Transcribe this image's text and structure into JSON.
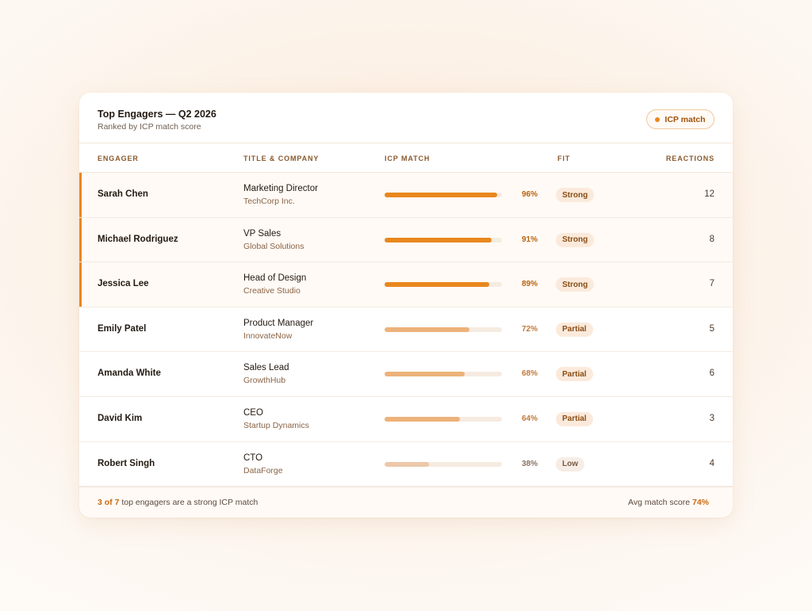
{
  "header": {
    "title": "Top Engagers — Q2 2026",
    "subtitle": "Ranked by ICP match score",
    "pill_label": "ICP match"
  },
  "columns": {
    "engager": "ENGAGER",
    "title_company": "TITLE & COMPANY",
    "icp_match": "ICP MATCH",
    "fit": "FIT",
    "reactions": "REACTIONS"
  },
  "rows": [
    {
      "name": "Sarah Chen",
      "title": "Marketing Director",
      "company": "TechCorp Inc.",
      "match_pct": 96,
      "match_label": "96%",
      "fit": "Strong",
      "reactions": "12"
    },
    {
      "name": "Michael Rodriguez",
      "title": "VP Sales",
      "company": "Global Solutions",
      "match_pct": 91,
      "match_label": "91%",
      "fit": "Strong",
      "reactions": "8"
    },
    {
      "name": "Jessica Lee",
      "title": "Head of Design",
      "company": "Creative Studio",
      "match_pct": 89,
      "match_label": "89%",
      "fit": "Strong",
      "reactions": "7"
    },
    {
      "name": "Emily Patel",
      "title": "Product Manager",
      "company": "InnovateNow",
      "match_pct": 72,
      "match_label": "72%",
      "fit": "Partial",
      "reactions": "5"
    },
    {
      "name": "Amanda White",
      "title": "Sales Lead",
      "company": "GrowthHub",
      "match_pct": 68,
      "match_label": "68%",
      "fit": "Partial",
      "reactions": "6"
    },
    {
      "name": "David Kim",
      "title": "CEO",
      "company": "Startup Dynamics",
      "match_pct": 64,
      "match_label": "64%",
      "fit": "Partial",
      "reactions": "3"
    },
    {
      "name": "Robert Singh",
      "title": "CTO",
      "company": "DataForge",
      "match_pct": 38,
      "match_label": "38%",
      "fit": "Low",
      "reactions": "4"
    }
  ],
  "footer": {
    "strong_count": "3 of 7",
    "strong_text": " top engagers are a strong ICP match",
    "avg_label": "Avg match score ",
    "avg_value": "74%"
  },
  "colors": {
    "strong_bar": "#e8871e",
    "partial_bar": "#edb27a",
    "low_bar": "#ecc8aa",
    "strong_pct": "#b8620e",
    "partial_pct": "#c07a3c",
    "low_pct": "#8a7262"
  }
}
